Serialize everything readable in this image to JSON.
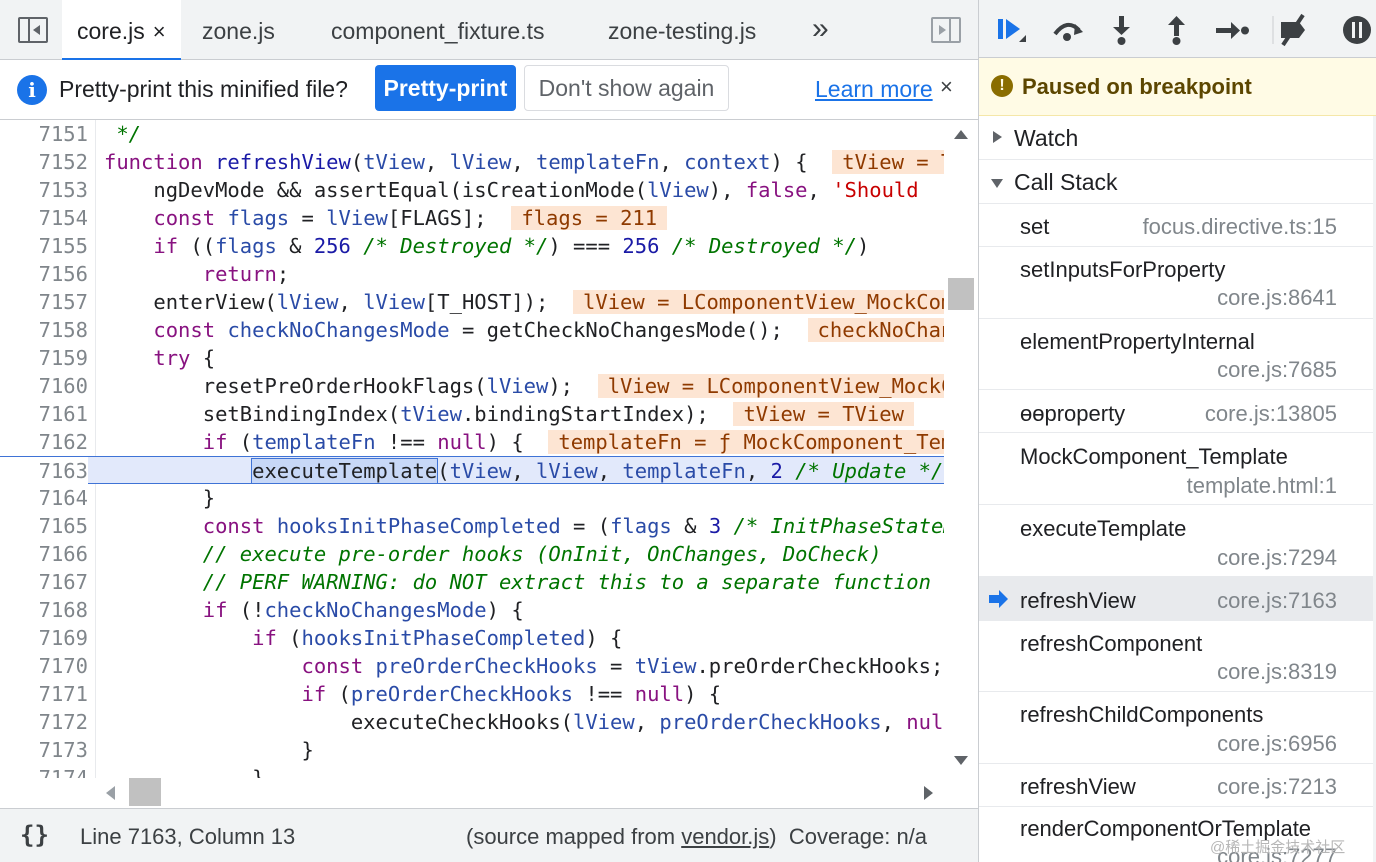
{
  "tabs": {
    "items": [
      {
        "label": "core.js",
        "active": true
      },
      {
        "label": "zone.js"
      },
      {
        "label": "component_fixture.ts"
      },
      {
        "label": "zone-testing.js"
      }
    ],
    "more": "»",
    "close_glyph": "×"
  },
  "infobar": {
    "message": "Pretty-print this minified file?",
    "primary_button": "Pretty-print",
    "secondary_button": "Don't show again",
    "link": "Learn more",
    "close": "×"
  },
  "code": {
    "current_line": "7163"
  },
  "status": {
    "braces": "{}",
    "position": "Line 7163, Column 13",
    "mapped_prefix": "(source mapped from ",
    "mapped_file": "vendor.js",
    "mapped_suffix": ")",
    "coverage": "Coverage: n/a"
  },
  "debugger": {
    "paused_message": "Paused on breakpoint",
    "watch_label": "Watch",
    "callstack_label": "Call Stack",
    "frames": [
      {
        "name": "set",
        "location": "focus.directive.ts:15"
      },
      {
        "name": "setInputsForProperty",
        "location": "core.js:8641"
      },
      {
        "name": "elementPropertyInternal",
        "location": "core.js:7685"
      },
      {
        "name": "ɵɵproperty",
        "location": "core.js:13805"
      },
      {
        "name": "MockComponent_Template",
        "location": "template.html:1"
      },
      {
        "name": "executeTemplate",
        "location": "core.js:7294"
      },
      {
        "name": "refreshView",
        "location": "core.js:7163",
        "selected": true
      },
      {
        "name": "refreshComponent",
        "location": "core.js:8319"
      },
      {
        "name": "refreshChildComponents",
        "location": "core.js:6956"
      },
      {
        "name": "refreshView",
        "location": "core.js:7213"
      },
      {
        "name": "renderComponentOrTemplate",
        "location": "core.js:7277"
      }
    ]
  },
  "watermark": "@稀土掘金技术社区",
  "colors": {
    "accent": "#1a73e8",
    "paused_bg": "#fffbe5",
    "inline_value_bg": "#fde5d3",
    "current_line_bg": "#e2e9fb"
  }
}
